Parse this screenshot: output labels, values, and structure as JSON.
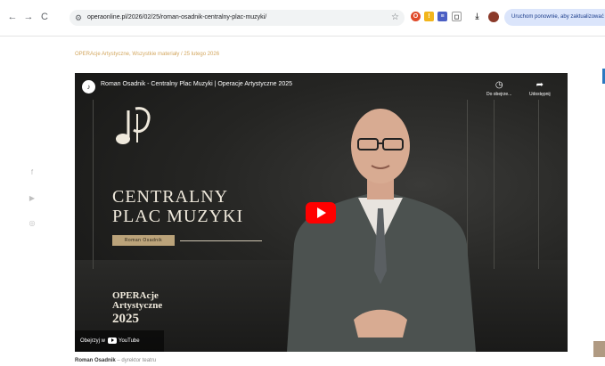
{
  "browser": {
    "url": "operaonline.pl/2026/02/25/roman-osadnik-centralny-plac-muzyki/",
    "update_label": "Uruchom ponownie, aby zaktualizować"
  },
  "breadcrumb": {
    "text": "OPERAcje Artystyczne, Wszystkie materiały  /  25 lutego 2026"
  },
  "video": {
    "title": "Roman Osadnik - Centralny Plac Muzyki | Operacje Artystyczne 2025",
    "watch_later": "Do obejrze...",
    "share": "Udostępnij",
    "headline_line1": "CENTRALNY",
    "headline_line2": "PLAC MUZYKI",
    "name_plate": "Roman Osadnik",
    "brand_line1": "OPERAcje",
    "brand_line2": "Artystyczne",
    "brand_year": "2025",
    "watch_on": "Obejrzyj w",
    "youtube": "YouTube"
  },
  "caption": {
    "name": "Roman Osadnik",
    "role": "– dyrektor teatru"
  },
  "colors": {
    "accent_gold": "#d3a75f",
    "youtube_red": "#ff0000",
    "update_pill": "#dbe5fb"
  }
}
